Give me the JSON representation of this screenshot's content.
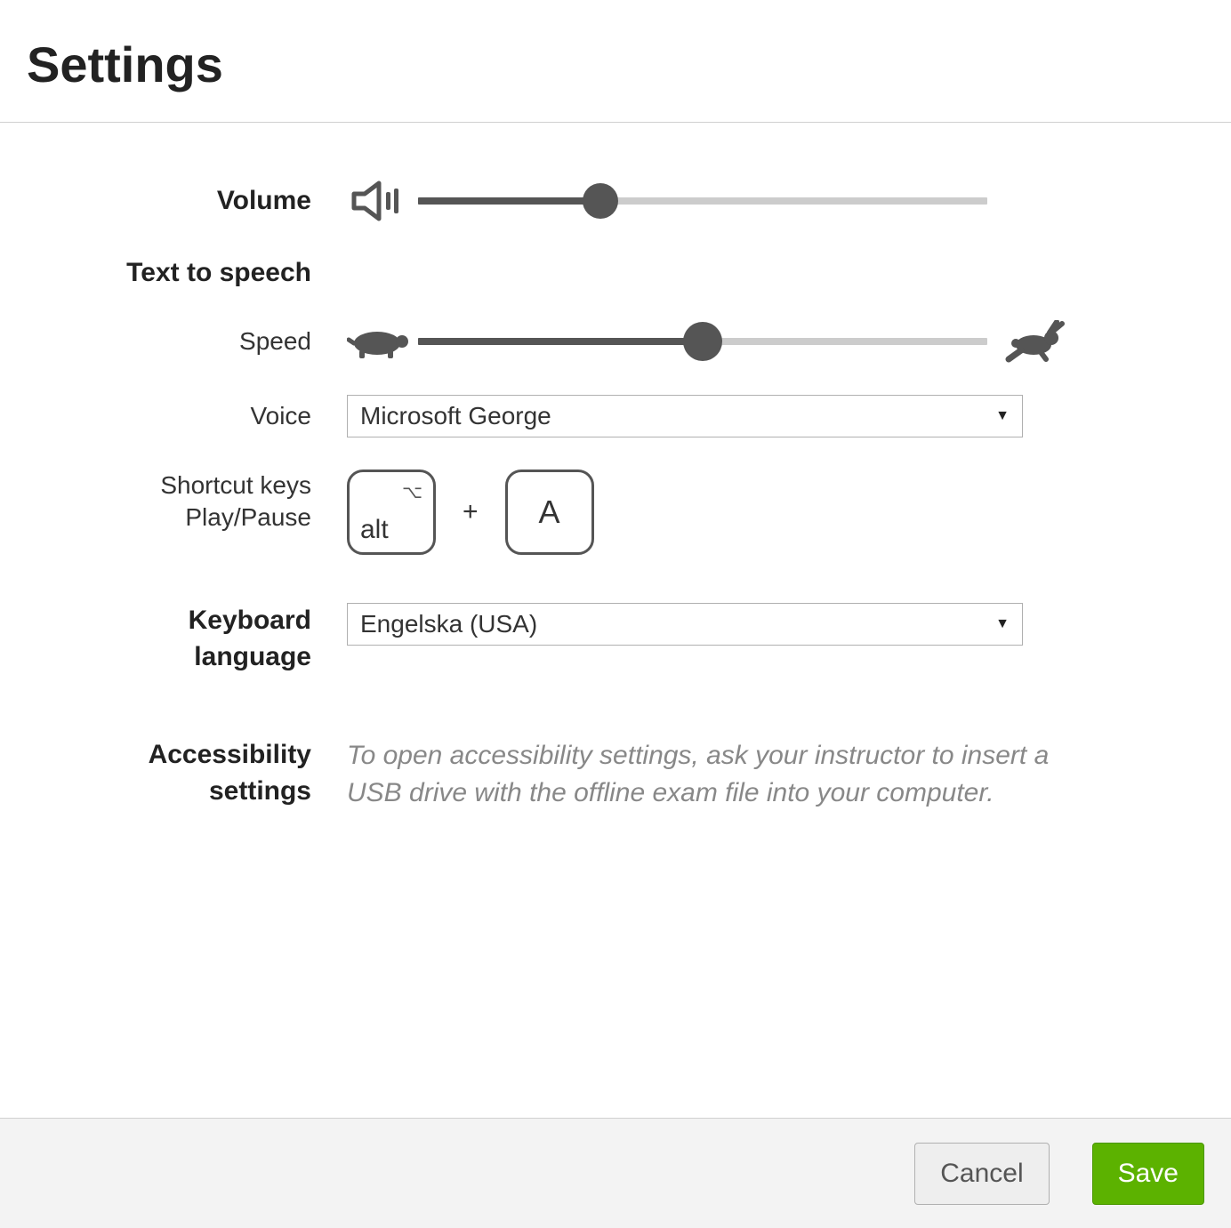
{
  "header": {
    "title": "Settings"
  },
  "volume": {
    "label": "Volume",
    "percent": 32
  },
  "tts": {
    "heading": "Text to speech",
    "speed": {
      "label": "Speed",
      "percent": 50
    },
    "voice": {
      "label": "Voice",
      "selected": "Microsoft George"
    },
    "shortcut": {
      "label_line1": "Shortcut keys",
      "label_line2": "Play/Pause",
      "key1": "alt",
      "plus": "+",
      "key2": "A"
    }
  },
  "keyboard": {
    "label_line1": "Keyboard",
    "label_line2": "language",
    "selected": "Engelska (USA)"
  },
  "accessibility": {
    "label_line1": "Accessibility",
    "label_line2": "settings",
    "info": "To open accessibility settings, ask your instructor to insert a USB drive with the offline exam file into your computer."
  },
  "footer": {
    "cancel": "Cancel",
    "save": "Save"
  },
  "colors": {
    "accent_green": "#5cb200",
    "slider_dark": "#555555",
    "slider_light": "#cccccc"
  }
}
